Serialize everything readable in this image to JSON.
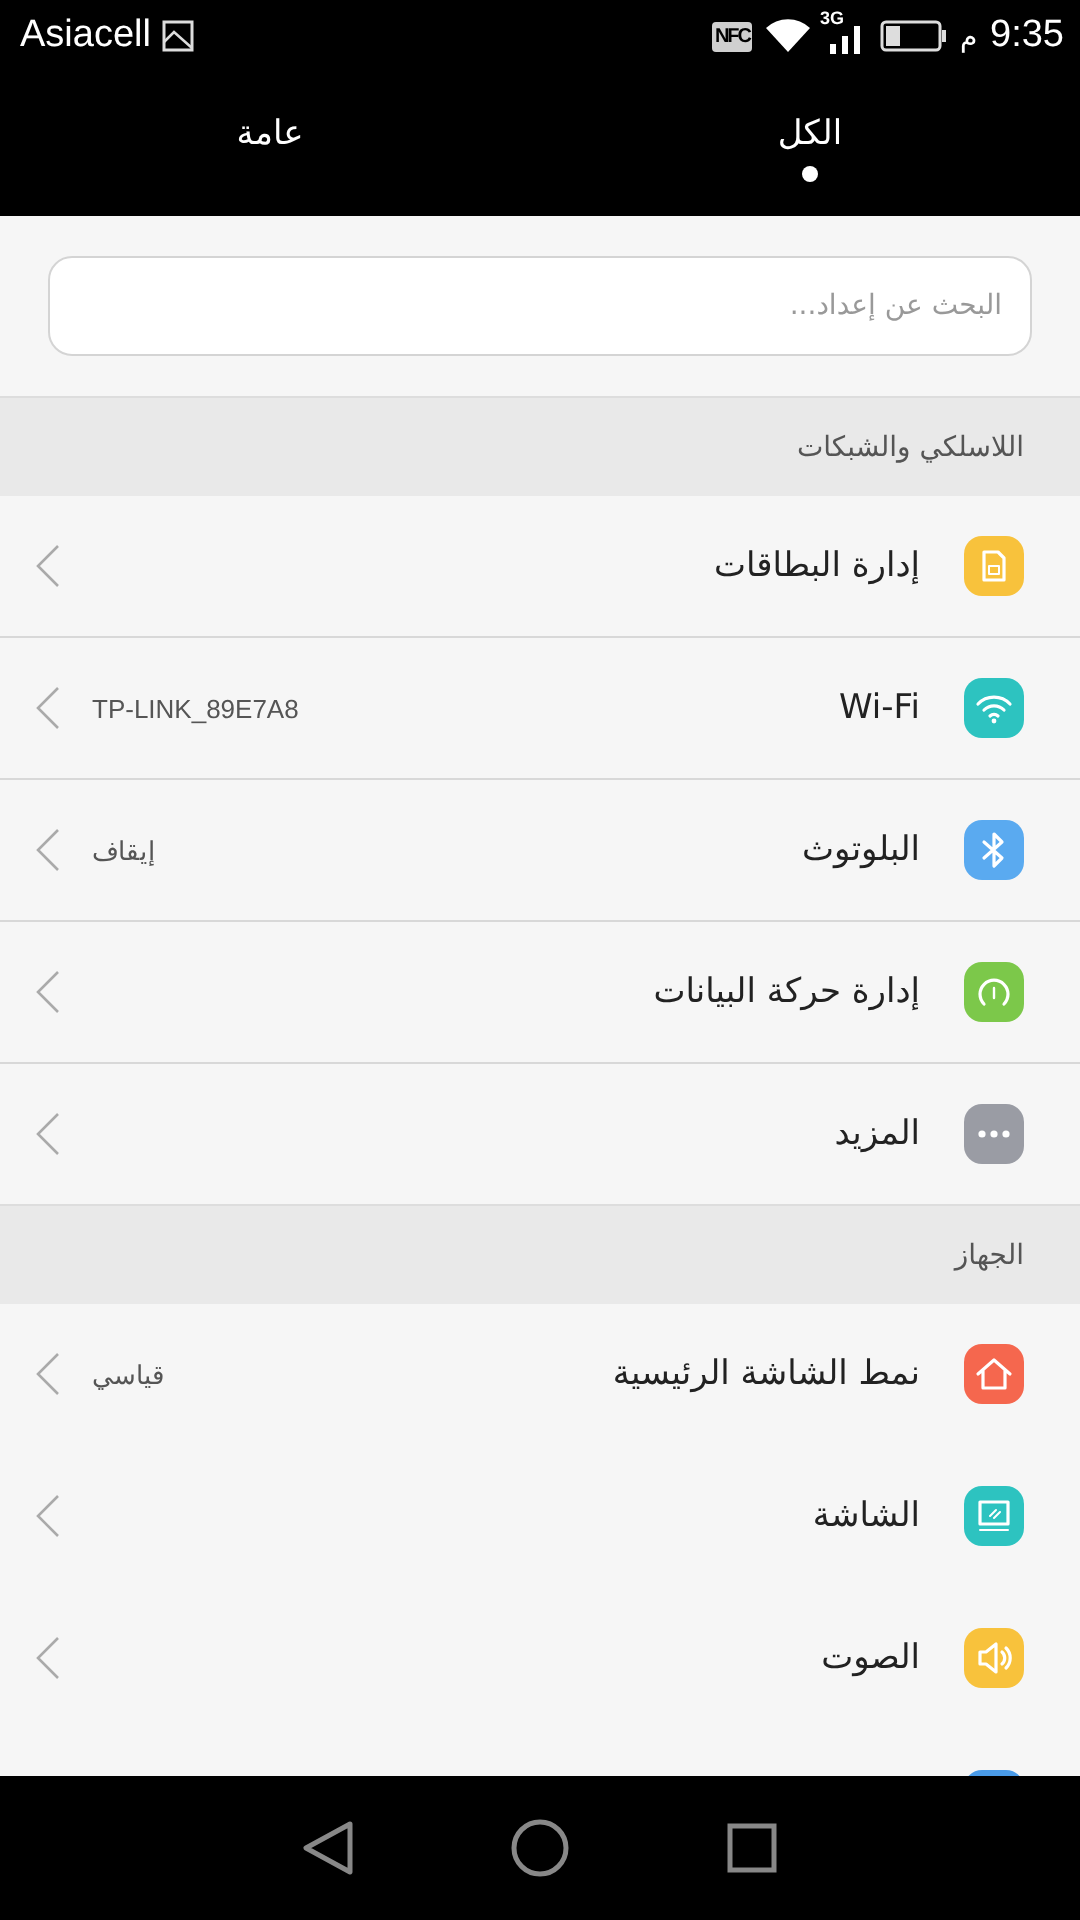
{
  "status_bar": {
    "carrier": "Asiacell",
    "nfc": "NFC",
    "network_type": "3G",
    "time": "9:35",
    "am_pm": "م"
  },
  "tabs": [
    {
      "label": "الكل",
      "selected": true
    },
    {
      "label": "عامة",
      "selected": false
    }
  ],
  "search": {
    "placeholder": "البحث عن إعداد..."
  },
  "sections": [
    {
      "title": "اللاسلكي والشبكات",
      "divided": true,
      "items": [
        {
          "label": "إدارة البطاقات",
          "kind": "sim",
          "color": "#f8c23c"
        },
        {
          "label": "Wi-Fi",
          "value": "TP-LINK_89E7A8",
          "kind": "wifi",
          "color": "#2dc3c0"
        },
        {
          "label": "البلوتوث",
          "value": "إيقاف",
          "kind": "bluetooth",
          "color": "#5aaaf0"
        },
        {
          "label": "إدارة حركة البيانات",
          "kind": "data",
          "color": "#7cc84a"
        },
        {
          "label": "المزيد",
          "kind": "more",
          "color": "#9a9ca4"
        }
      ]
    },
    {
      "title": "الجهاز",
      "divided": false,
      "items": [
        {
          "label": "نمط الشاشة الرئيسية",
          "value": "قياسي",
          "kind": "home",
          "color": "#f5674e"
        },
        {
          "label": "الشاشة",
          "kind": "display",
          "color": "#2dc3c0"
        },
        {
          "label": "الصوت",
          "kind": "sound",
          "color": "#f8c23c"
        },
        {
          "kind": "other",
          "color": "#4a9be8"
        }
      ]
    }
  ]
}
